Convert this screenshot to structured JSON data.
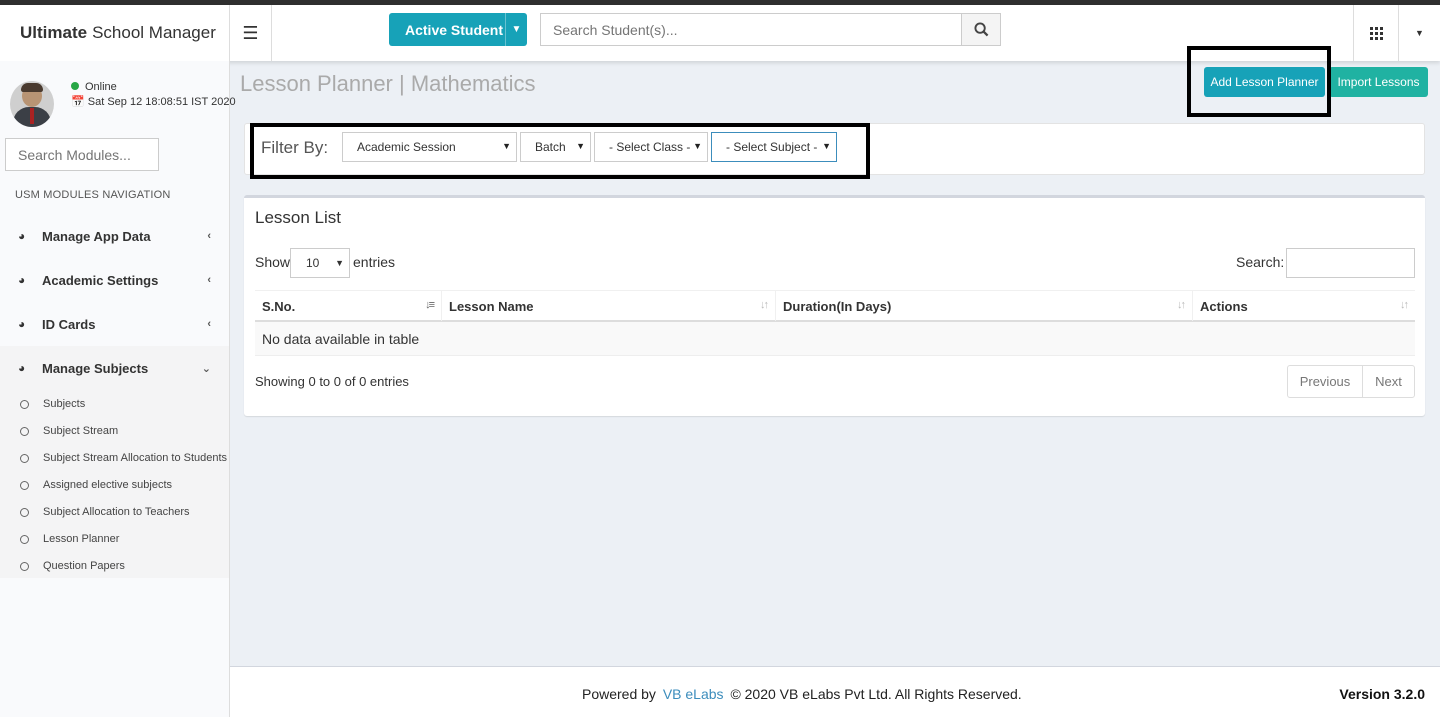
{
  "header": {
    "logo_bold": "Ultimate",
    "logo_rest": "School Manager",
    "active_student_label": "Active Student",
    "student_search_placeholder": "Search Student(s)..."
  },
  "user": {
    "status": "Online",
    "datetime": "Sat Sep 12 18:08:51 IST 2020"
  },
  "sidebar": {
    "module_search_placeholder": "Search Modules...",
    "nav_header": "USM MODULES NAVIGATION",
    "menu": [
      {
        "label": "Manage App Data",
        "chevron": "‹"
      },
      {
        "label": "Academic Settings",
        "chevron": "‹"
      },
      {
        "label": "ID Cards",
        "chevron": "‹"
      },
      {
        "label": "Manage Subjects",
        "chevron": "⌄"
      }
    ],
    "submenu": [
      "Subjects",
      "Subject Stream",
      "Subject Stream Allocation to Students",
      "Assigned elective subjects",
      "Subject Allocation to Teachers",
      "Lesson Planner",
      "Question Papers"
    ]
  },
  "page": {
    "title": "Lesson Planner | Mathematics",
    "add_button": "Add Lesson Planner",
    "import_button": "Import Lessons"
  },
  "filter": {
    "label": "Filter By:",
    "session": "Academic Session",
    "batch": "Batch",
    "class": "- Select Class -",
    "subject": "- Select Subject -"
  },
  "lesson_list": {
    "title": "Lesson List",
    "show_label": "Show",
    "entries_value": "10",
    "entries_label": "entries",
    "search_label": "Search:",
    "columns": [
      "S.No.",
      "Lesson Name",
      "Duration(In Days)",
      "Actions"
    ],
    "empty_text": "No data available in table",
    "showing_text": "Showing 0 to 0 of 0 entries",
    "previous": "Previous",
    "next": "Next"
  },
  "footer": {
    "powered_by": "Powered by",
    "company_link": "VB eLabs",
    "copyright": "© 2020 VB eLabs Pvt Ltd. All Rights Reserved.",
    "version": "Version 3.2.0"
  },
  "colors": {
    "accent": "#17a2b8",
    "import_button": "#20b2a2",
    "link": "#3c8dbc",
    "online": "#28a745"
  }
}
